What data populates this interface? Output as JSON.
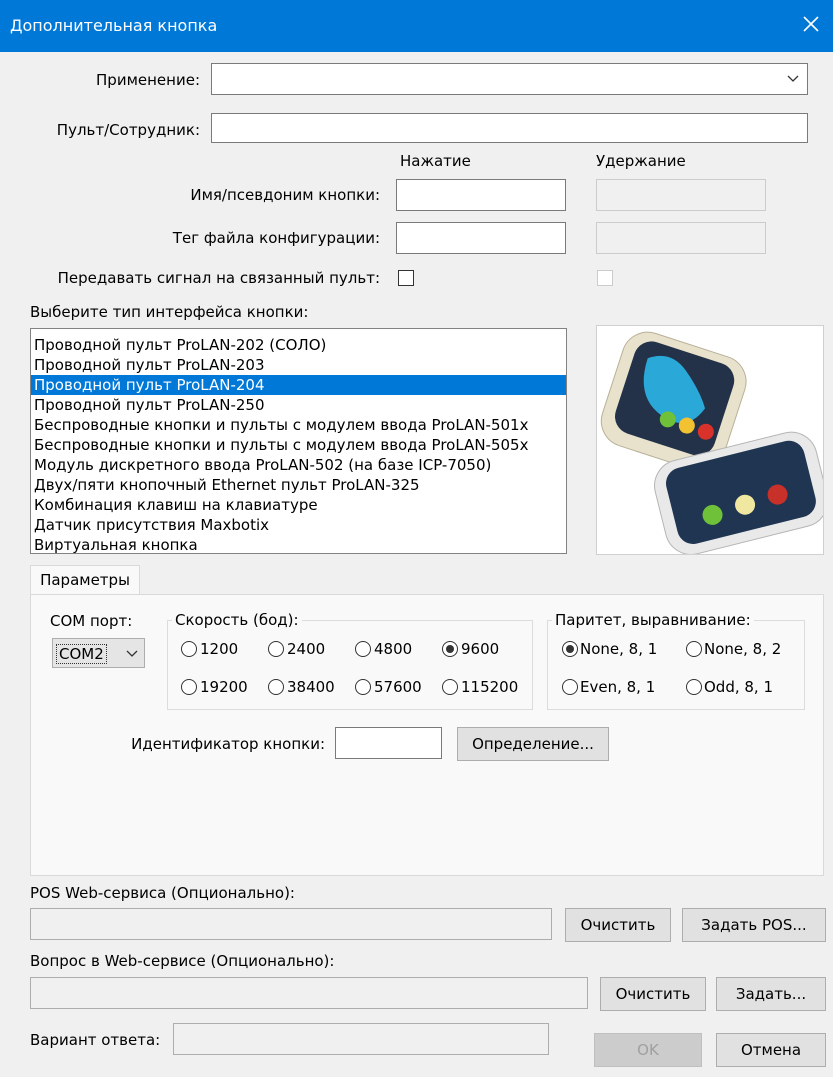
{
  "window": {
    "title": "Дополнительная кнопка"
  },
  "form": {
    "application_label": "Применение:",
    "application_value": "",
    "remote_label": "Пульт/Сотрудник:",
    "remote_value": "",
    "col_press": "Нажатие",
    "col_hold": "Удержание",
    "button_name_label": "Имя/псевдоним кнопки:",
    "config_tag_label": "Тег файла конфигурации:",
    "send_signal_label": "Передавать сигнал на связанный пульт:"
  },
  "interface": {
    "label": "Выберите тип интерфейса кнопки:",
    "items": [
      "Проводной пульт ProLAN-202 (СОЛО)",
      "Проводной пульт ProLAN-203",
      "Проводной пульт ProLAN-204",
      "Проводной пульт ProLAN-250",
      "Беспроводные кнопки и пульты с модулем ввода ProLAN-501x",
      "Беспроводные кнопки и пульты с модулем ввода ProLAN-505x",
      "Модуль дискретного ввода ProLAN-502 (на базе ICP-7050)",
      "Двух/пяти кнопочный Ethernet пульт ProLAN-325",
      "Комбинация клавиш на клавиатуре",
      "Датчик присутствия Maxbotix",
      "Виртуальная кнопка"
    ],
    "selected_index": 2
  },
  "params": {
    "tab_label": "Параметры",
    "com_label": "COM порт:",
    "com_value": "COM2",
    "speed_label": "Скорость (бод):",
    "speeds": [
      "1200",
      "2400",
      "4800",
      "9600",
      "19200",
      "38400",
      "57600",
      "115200"
    ],
    "speed_selected": "9600",
    "parity_label": "Паритет, выравнивание:",
    "parities": [
      "None, 8, 1",
      "None, 8, 2",
      "Even, 8, 1",
      "Odd, 8, 1"
    ],
    "parity_selected": "None, 8, 1",
    "button_id_label": "Идентификатор кнопки:",
    "button_id_value": "",
    "detect_button": "Определение..."
  },
  "web": {
    "pos_label": "POS Web-сервиса (Опционально):",
    "pos_clear": "Очистить",
    "pos_set": "Задать POS...",
    "question_label": "Вопрос в Web-сервисе (Опционально):",
    "question_clear": "Очистить",
    "question_set": "Задать...",
    "answer_label": "Вариант ответа:"
  },
  "footer": {
    "ok": "OK",
    "cancel": "Отмена"
  },
  "colors": {
    "accent": "#0078d7",
    "selection": "#0078d7"
  }
}
